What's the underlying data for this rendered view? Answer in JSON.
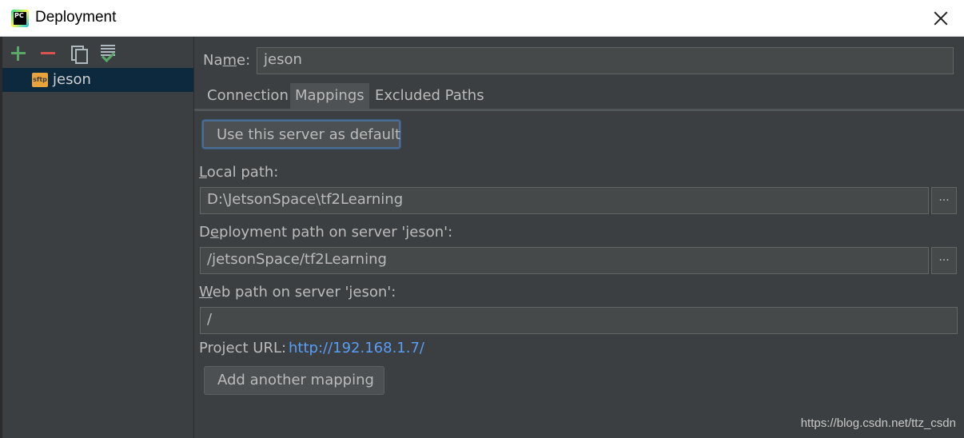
{
  "window": {
    "title": "Deployment",
    "app_icon_text": "PC"
  },
  "toolbar": {
    "icons": [
      "plus-icon",
      "minus-icon",
      "copy-icon",
      "default-server-icon"
    ]
  },
  "servers": [
    {
      "name": "jeson",
      "type_badge": "sftp",
      "selected": true
    }
  ],
  "form": {
    "name_label_pre": "Na",
    "name_label_ul": "m",
    "name_label_post": "e:",
    "name_value": "jeson"
  },
  "tabs": [
    {
      "label": "Connection",
      "selected": false
    },
    {
      "label": "Mappings",
      "selected": true
    },
    {
      "label": "Excluded Paths",
      "selected": false
    }
  ],
  "mappings": {
    "default_button": "Use this server as default",
    "local_path_label_ul": "L",
    "local_path_label_rest": "ocal path:",
    "local_path_value": "D:\\JetsonSpace\\tf2Learning",
    "deploy_path_label_pre": "D",
    "deploy_path_label_ul": "e",
    "deploy_path_label_rest": "ployment path on server 'jeson':",
    "deploy_path_value": "/jetsonSpace/tf2Learning",
    "web_path_label_ul": "W",
    "web_path_label_rest": "eb path on server 'jeson':",
    "web_path_value": "/",
    "project_url_label": "Project URL:",
    "project_url_value": "http://192.168.1.7/",
    "add_mapping_button": "Add another mapping",
    "browse_label": "..."
  },
  "watermark": "https://blog.csdn.net/ttz_csdn"
}
